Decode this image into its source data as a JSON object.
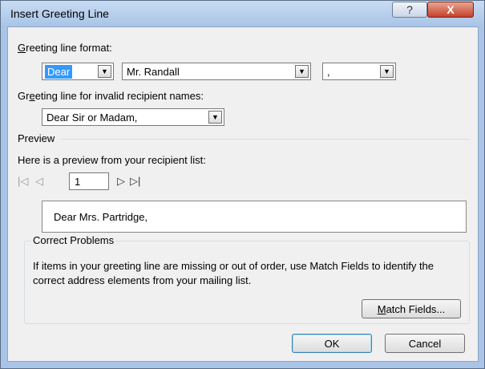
{
  "window": {
    "title": "Insert Greeting Line",
    "help_label": "?",
    "close_label": "X"
  },
  "greeting_format": {
    "label_prefix": "",
    "label_mnemonic": "G",
    "label_rest": "reeting line format:",
    "salutation": "Dear",
    "name_format": "Mr. Randall",
    "punctuation": ","
  },
  "invalid_names": {
    "label_pre": "Gr",
    "label_mnemonic": "e",
    "label_rest": "eting line for invalid recipient names:",
    "value": "Dear Sir or Madam,"
  },
  "preview": {
    "section_label": "Preview",
    "description": "Here is a preview from your recipient list:",
    "record_number": "1",
    "preview_text": "Dear Mrs. Partridge,"
  },
  "correct_problems": {
    "title": "Correct Problems",
    "description": "If items in your greeting line are missing or out of order, use Match Fields to identify the correct address elements from your mailing list.",
    "match_mnemonic": "M",
    "match_rest": "atch Fields..."
  },
  "buttons": {
    "ok": "OK",
    "cancel": "Cancel"
  },
  "icons": {
    "first": "first-record-icon",
    "prev": "previous-record-icon",
    "next": "next-record-icon",
    "last": "last-record-icon",
    "dropdown": "chevron-down-icon"
  }
}
